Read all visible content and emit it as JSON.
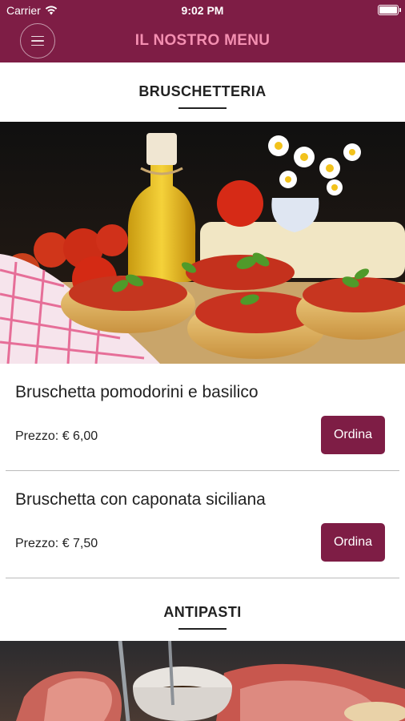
{
  "status_bar": {
    "carrier": "Carrier",
    "time": "9:02 PM"
  },
  "header": {
    "title": "IL NOSTRO MENU"
  },
  "sections": [
    {
      "title": "BRUSCHETTERIA",
      "items": [
        {
          "name": "Bruschetta pomodorini e basilico",
          "price": "Prezzo: € 6,00",
          "order_label": "Ordina"
        },
        {
          "name": "Bruschetta con caponata siciliana",
          "price": "Prezzo: € 7,50",
          "order_label": "Ordina"
        }
      ]
    },
    {
      "title": "ANTIPASTI"
    }
  ],
  "colors": {
    "brand": "#7e1d45",
    "title_pink": "#f48fb1"
  }
}
